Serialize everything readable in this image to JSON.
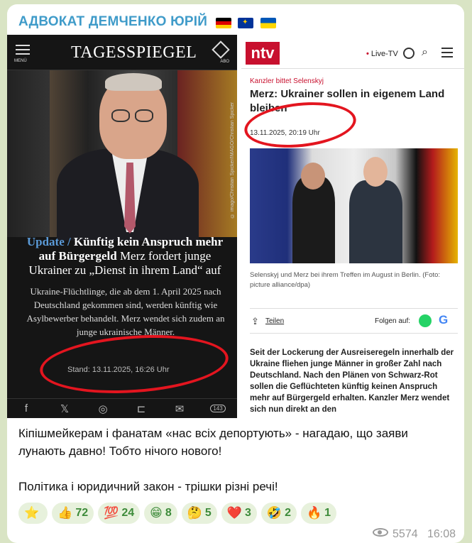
{
  "channel": {
    "name": "АДВОКАТ ДЕМЧЕНКО ЮРІЙ",
    "flags": [
      "flag-de-icon",
      "flag-eu-icon",
      "flag-ua-icon"
    ]
  },
  "tagesspiegel": {
    "menu_label": "MENÜ",
    "logo": "TAGESSPIEGEL",
    "abo_label": "ABO",
    "photo_credit": "© imago/Christian Spicker/IMAGO/Christian Spicker",
    "update_label": "Update /",
    "headline_bold": "Künftig kein Anspruch mehr auf Bürgergeld",
    "headline_rest": "Merz fordert junge Ukrainer zu „Dienst in ihrem Land“ auf",
    "body": "Ukraine-Flüchtlinge, die ab dem 1. April 2025 nach Deutschland gekommen sind, werden künftig wie Asylbewerber behandelt. Merz wendet sich zudem an junge ukrainische Männer.",
    "stand": "Stand: 13.11.2025, 16:26 Uhr",
    "share_icons": [
      "f",
      "𝕏",
      "◎",
      "⊏",
      "✉"
    ],
    "comment_count": "143"
  },
  "ntv": {
    "logo": "ntv",
    "live_label": "Live-TV",
    "kicker": "Kanzler bittet Selenskyj",
    "title": "Merz: Ukrainer sollen in eigenem Land bleiben",
    "date": "13.11.2025, 20:19 Uhr",
    "caption": "Selenskyj und Merz bei ihrem Treffen im August in Berlin. (Foto: picture alliance/dpa)",
    "share_label": "Teilen",
    "follow_label": "Folgen auf:",
    "body": "Seit der Lockerung der Ausreiseregeln innerhalb der Ukraine fliehen junge Männer in großer Zahl nach Deutschland. Nach den Plänen von Schwarz-Rot sollen die Geflüchteten künftig keinen Anspruch mehr auf Bürgergeld erhalten. Kanzler Merz wendet sich nun direkt an den"
  },
  "message": {
    "paragraph1": "Кіпішмейкерам і фанатам «нас всіх депортують» - нагадаю, що заяви лунають давно! Тобто нічого нового!",
    "paragraph2": "Політика і юридичний закон - трішки різні речі!"
  },
  "reactions": [
    {
      "emoji": "⭐",
      "count": ""
    },
    {
      "emoji": "👍",
      "count": "72"
    },
    {
      "emoji": "💯",
      "count": "24"
    },
    {
      "emoji": "😁",
      "count": "8"
    },
    {
      "emoji": "🤔",
      "count": "5"
    },
    {
      "emoji": "❤️",
      "count": "3"
    },
    {
      "emoji": "🤣",
      "count": "2"
    },
    {
      "emoji": "🔥",
      "count": "1"
    }
  ],
  "meta": {
    "views": "5574",
    "time": "16:08"
  }
}
